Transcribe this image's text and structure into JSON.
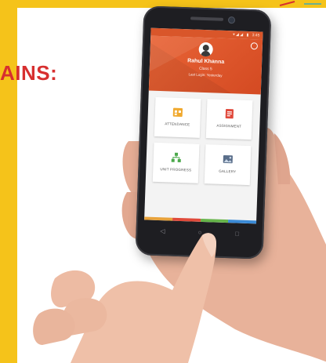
{
  "banner": {
    "heading": "AINS:"
  },
  "phone": {
    "status_bar": {
      "signal": "▾ ◢ ◢",
      "battery": "▮",
      "time": "3:45"
    },
    "profile": {
      "name": "Rahul Khanna",
      "class_text": "Class 5",
      "last_login": "Last Login: Yesterday"
    },
    "tiles": [
      {
        "label": "ATTENDANCE",
        "icon": "attendance-icon"
      },
      {
        "label": "ASSIGNMENT",
        "icon": "assignment-icon"
      },
      {
        "label": "UNIT PROGRESS",
        "icon": "unit-progress-icon"
      },
      {
        "label": "GALLERY",
        "icon": "gallery-icon"
      }
    ],
    "strip_colors": [
      "#e8a23a",
      "#e04a3a",
      "#66b44a",
      "#3a8ad6"
    ],
    "nav": {
      "back": "◁",
      "home": "○",
      "recents": "□"
    }
  },
  "colors": {
    "accent_yellow": "#f5c31a",
    "header_orange": "#e0582c",
    "heading_red": "#d72f2f"
  }
}
